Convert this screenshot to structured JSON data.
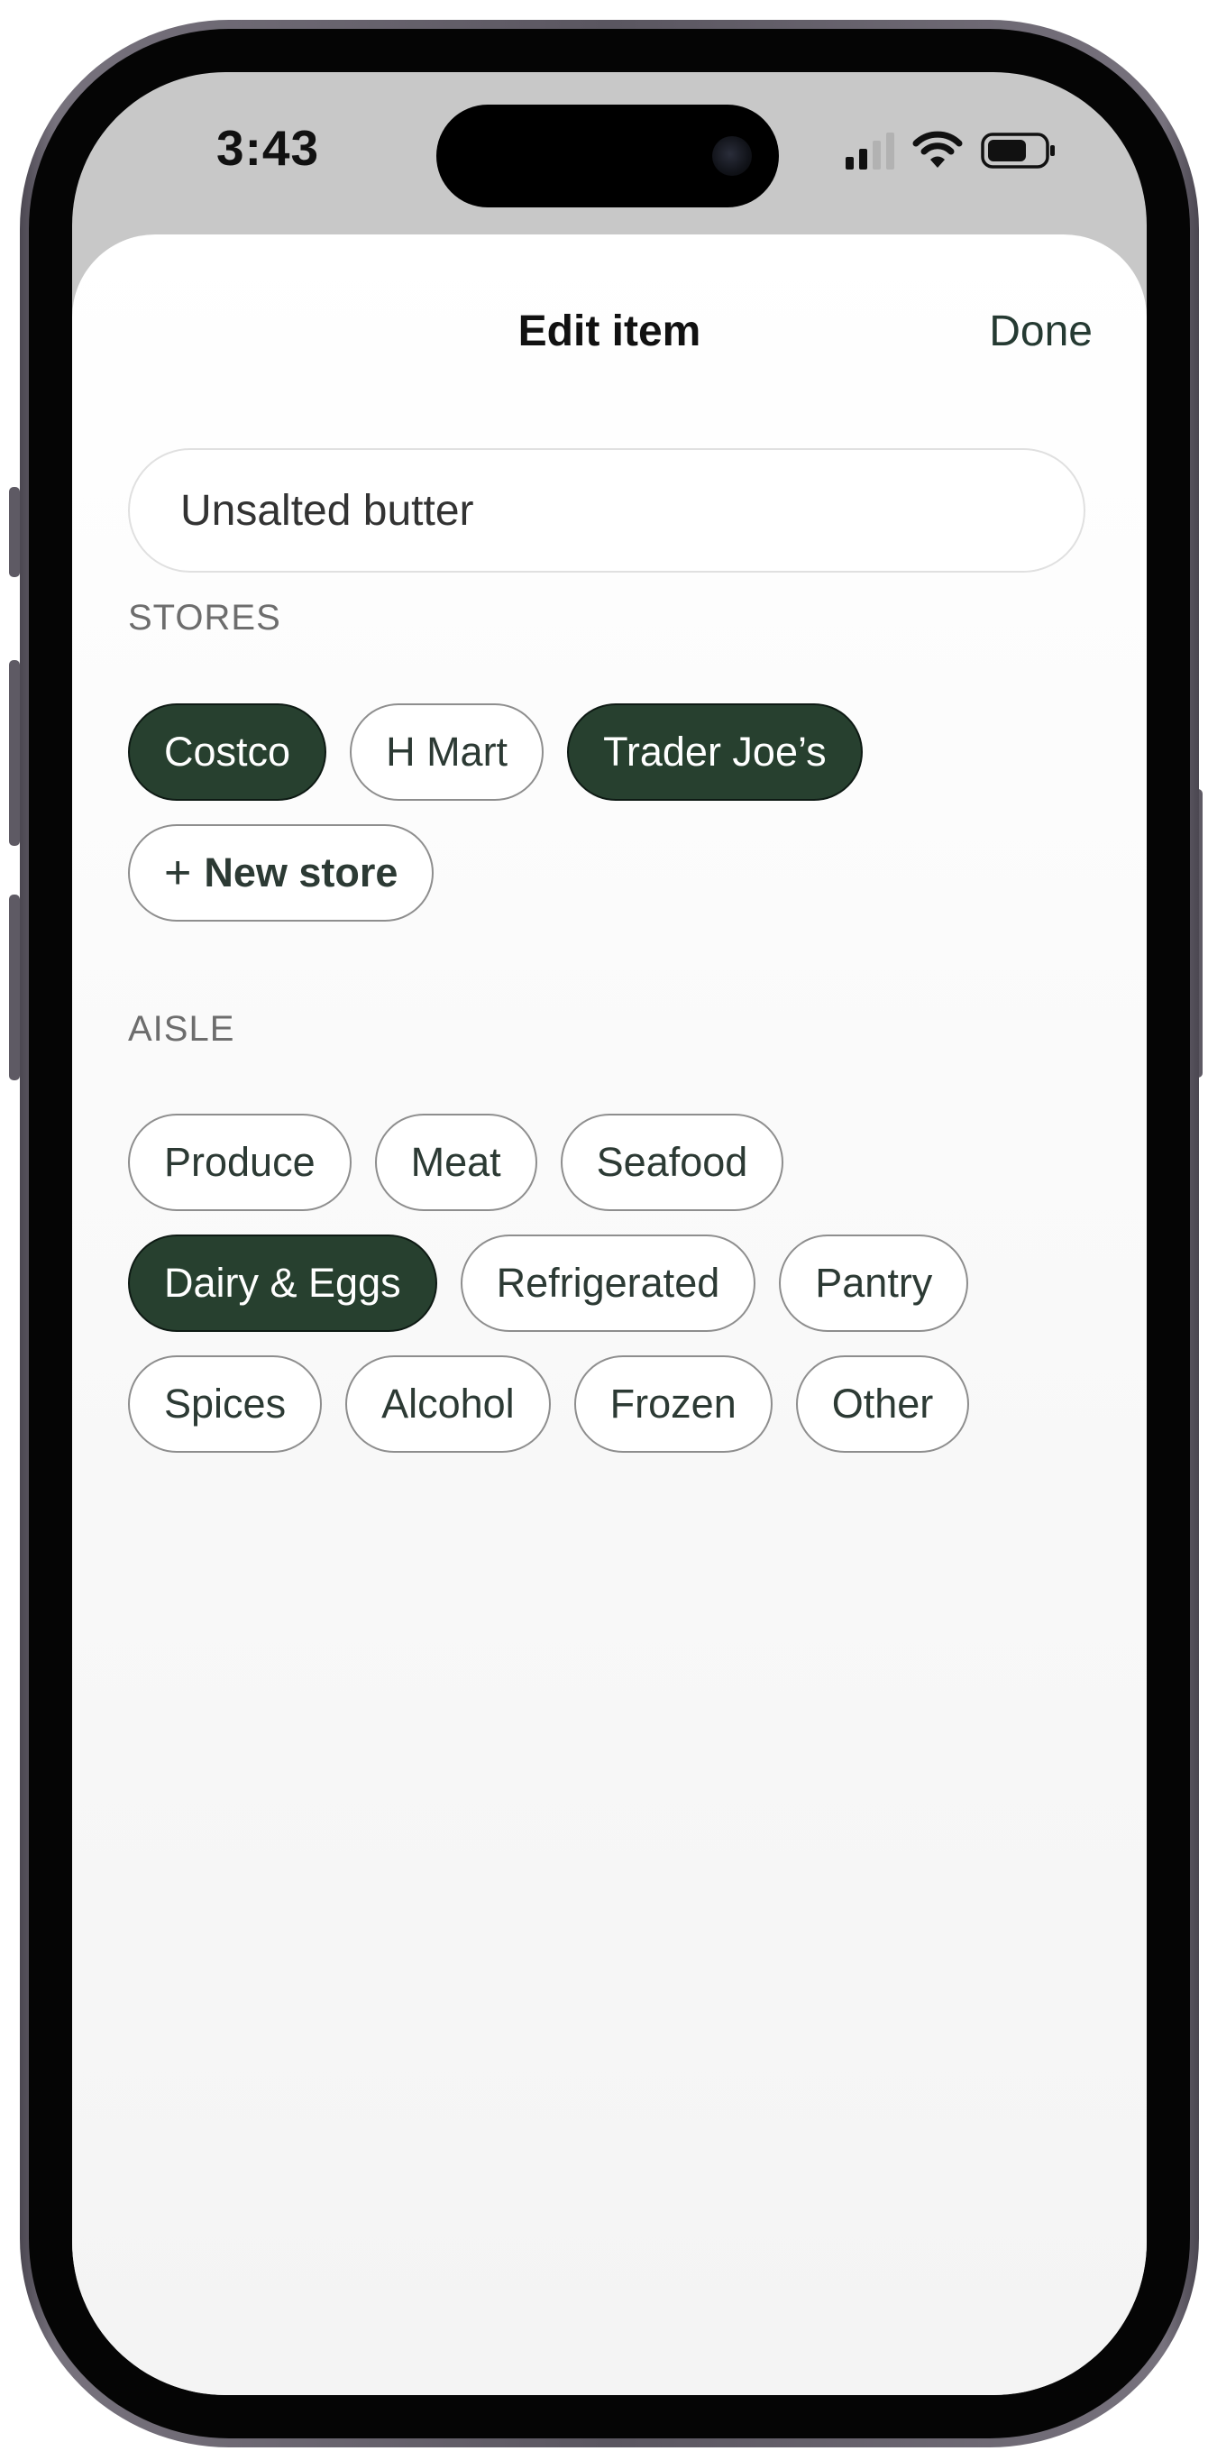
{
  "status_bar": {
    "time": "3:43",
    "icons": [
      "cellular-signal-icon",
      "wifi-icon",
      "battery-icon"
    ]
  },
  "sheet": {
    "title": "Edit item",
    "done_label": "Done",
    "item_name": "Unsalted butter"
  },
  "stores": {
    "label": "STORES",
    "items": [
      {
        "label": "Costco",
        "selected": true
      },
      {
        "label": "H Mart",
        "selected": false
      },
      {
        "label": "Trader Joe’s",
        "selected": true
      }
    ],
    "new_store_label": "New store",
    "new_store_icon": "+"
  },
  "aisle": {
    "label": "AISLE",
    "items": [
      {
        "label": "Produce",
        "selected": false
      },
      {
        "label": "Meat",
        "selected": false
      },
      {
        "label": "Seafood",
        "selected": false
      },
      {
        "label": "Dairy & Eggs",
        "selected": true
      },
      {
        "label": "Refrigerated",
        "selected": false
      },
      {
        "label": "Pantry",
        "selected": false
      },
      {
        "label": "Spices",
        "selected": false
      },
      {
        "label": "Alcohol",
        "selected": false
      },
      {
        "label": "Frozen",
        "selected": false
      },
      {
        "label": "Other",
        "selected": false
      }
    ]
  },
  "colors": {
    "accent": "#27402f",
    "chip_border": "#8e8e8e",
    "text": "#2c3a34"
  }
}
